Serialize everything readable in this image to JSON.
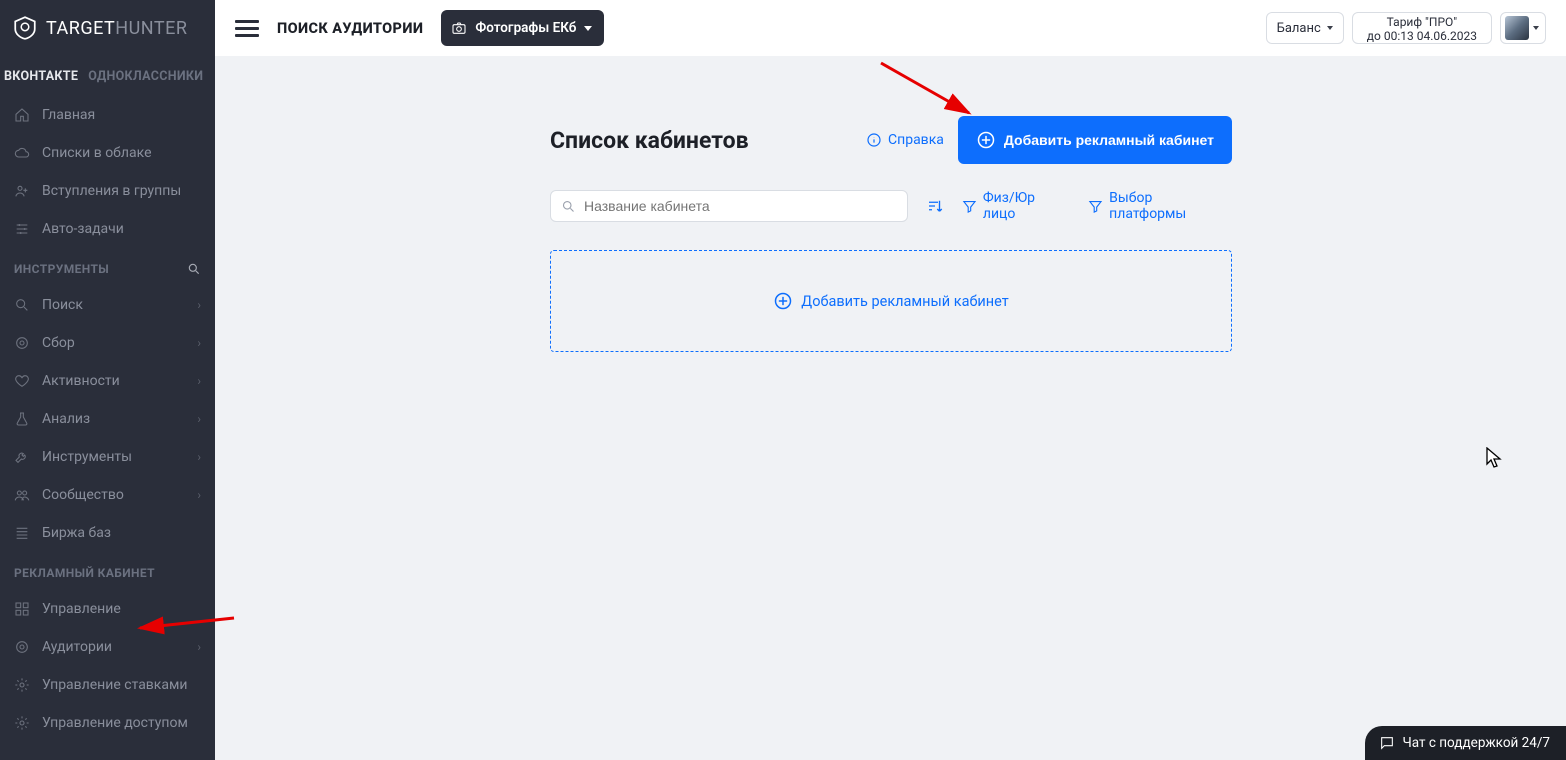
{
  "brand": {
    "name1": "TARGET",
    "name2": "HUNTER"
  },
  "social_tabs": {
    "vk": "ВКОНТАКТЕ",
    "ok": "ОДНОКЛАССНИКИ"
  },
  "nav_primary": [
    {
      "label": "Главная"
    },
    {
      "label": "Списки в облаке"
    },
    {
      "label": "Вступления в группы"
    },
    {
      "label": "Авто-задачи"
    }
  ],
  "section_tools": "ИНСТРУМЕНТЫ",
  "nav_tools": [
    {
      "label": "Поиск",
      "expand": true
    },
    {
      "label": "Сбор",
      "expand": true
    },
    {
      "label": "Активности",
      "expand": true
    },
    {
      "label": "Анализ",
      "expand": true
    },
    {
      "label": "Инструменты",
      "expand": true
    },
    {
      "label": "Сообщество",
      "expand": true
    },
    {
      "label": "Биржа баз",
      "expand": false
    }
  ],
  "section_cabinet": "РЕКЛАМНЫЙ КАБИНЕТ",
  "nav_cabinet": [
    {
      "label": "Управление",
      "expand": false
    },
    {
      "label": "Аудитории",
      "expand": true
    },
    {
      "label": "Управление ставками",
      "expand": false
    },
    {
      "label": "Управление доступом",
      "expand": false
    }
  ],
  "header": {
    "title": "ПОИСК АУДИТОРИИ",
    "project": "Фотографы ЕКб",
    "balance_label": "Баланс",
    "tariff_line1": "Тариф \"ПРО\"",
    "tariff_line2": "до 00:13 04.06.2023"
  },
  "main": {
    "title": "Список кабинетов",
    "help": "Справка",
    "add_button": "Добавить рекламный кабинет",
    "search_placeholder": "Название кабинета",
    "filter_person": "Физ/Юр лицо",
    "filter_platform": "Выбор платформы",
    "empty_add": "Добавить рекламный кабинет"
  },
  "chat": {
    "label": "Чат с поддержкой 24/7"
  }
}
